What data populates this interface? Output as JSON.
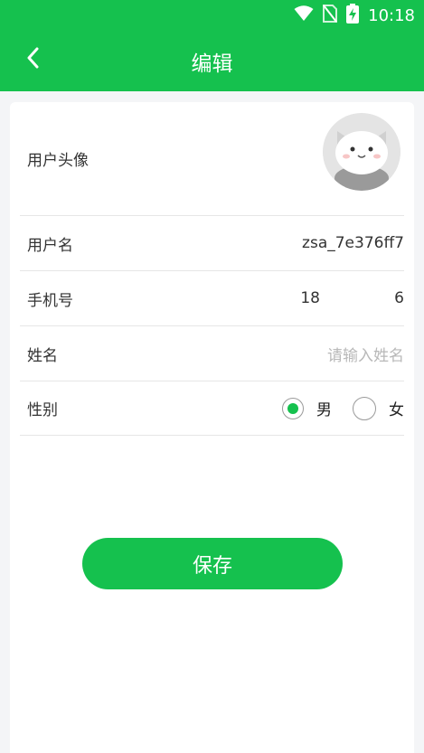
{
  "status_bar": {
    "time": "10:18",
    "icons": [
      "wifi-icon",
      "no-sim-icon",
      "battery-charging-icon"
    ]
  },
  "header": {
    "back_icon": "chevron-left-icon",
    "title": "编辑"
  },
  "form": {
    "avatar": {
      "label": "用户头像"
    },
    "username": {
      "label": "用户名",
      "value": "zsa_7e376ff7"
    },
    "phone": {
      "label": "手机号",
      "value_left": "18",
      "value_right": "6"
    },
    "name": {
      "label": "姓名",
      "placeholder": "请输入姓名",
      "value": ""
    },
    "gender": {
      "label": "性别",
      "options": [
        "男",
        "女"
      ],
      "selected": "男"
    }
  },
  "actions": {
    "save_label": "保存"
  },
  "colors": {
    "accent": "#15c14e",
    "background": "#f4f5f7",
    "card": "#ffffff",
    "text": "#333333",
    "placeholder": "#b8b8b8",
    "divider": "#e6e6e6"
  }
}
